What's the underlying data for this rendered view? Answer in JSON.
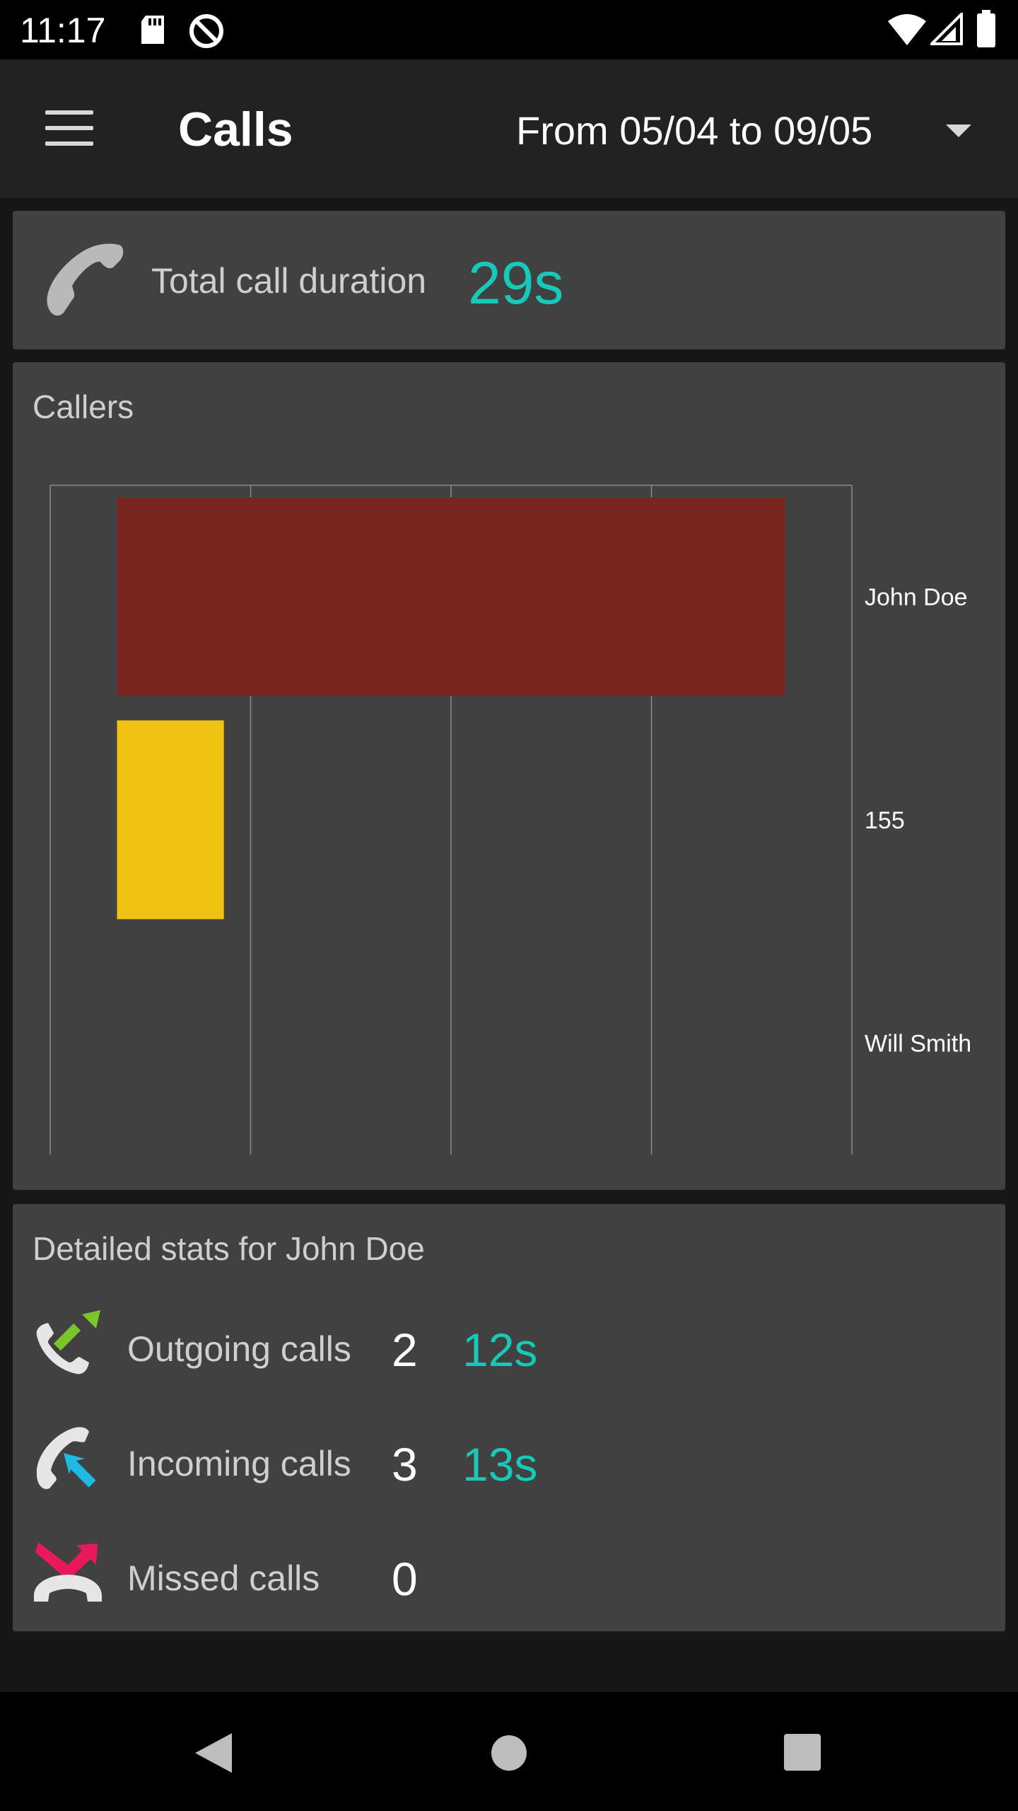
{
  "status_bar": {
    "time": "11:17"
  },
  "app_bar": {
    "title": "Calls",
    "date_range": "From 05/04 to 09/05"
  },
  "total_card": {
    "label": "Total call duration",
    "value": "29s"
  },
  "callers_card": {
    "title": "Callers"
  },
  "chart_data": {
    "type": "bar",
    "orientation": "horizontal",
    "categories": [
      "John Doe",
      "155",
      "Will Smith"
    ],
    "values": [
      25,
      4,
      0
    ],
    "colors": [
      "#7a2620",
      "#f0c312",
      "#414141"
    ],
    "xlim": [
      -2.5,
      27.5
    ],
    "grid": true
  },
  "details_card": {
    "title": "Detailed stats for John Doe",
    "rows": [
      {
        "icon": "outgoing-call-icon",
        "label": "Outgoing calls",
        "count": "2",
        "duration": "12s"
      },
      {
        "icon": "incoming-call-icon",
        "label": "Incoming calls",
        "count": "3",
        "duration": "13s"
      },
      {
        "icon": "missed-call-icon",
        "label": "Missed calls",
        "count": "0",
        "duration": ""
      }
    ]
  },
  "colors": {
    "accent": "#16c9b8",
    "card": "#414141",
    "background": "#171717"
  }
}
